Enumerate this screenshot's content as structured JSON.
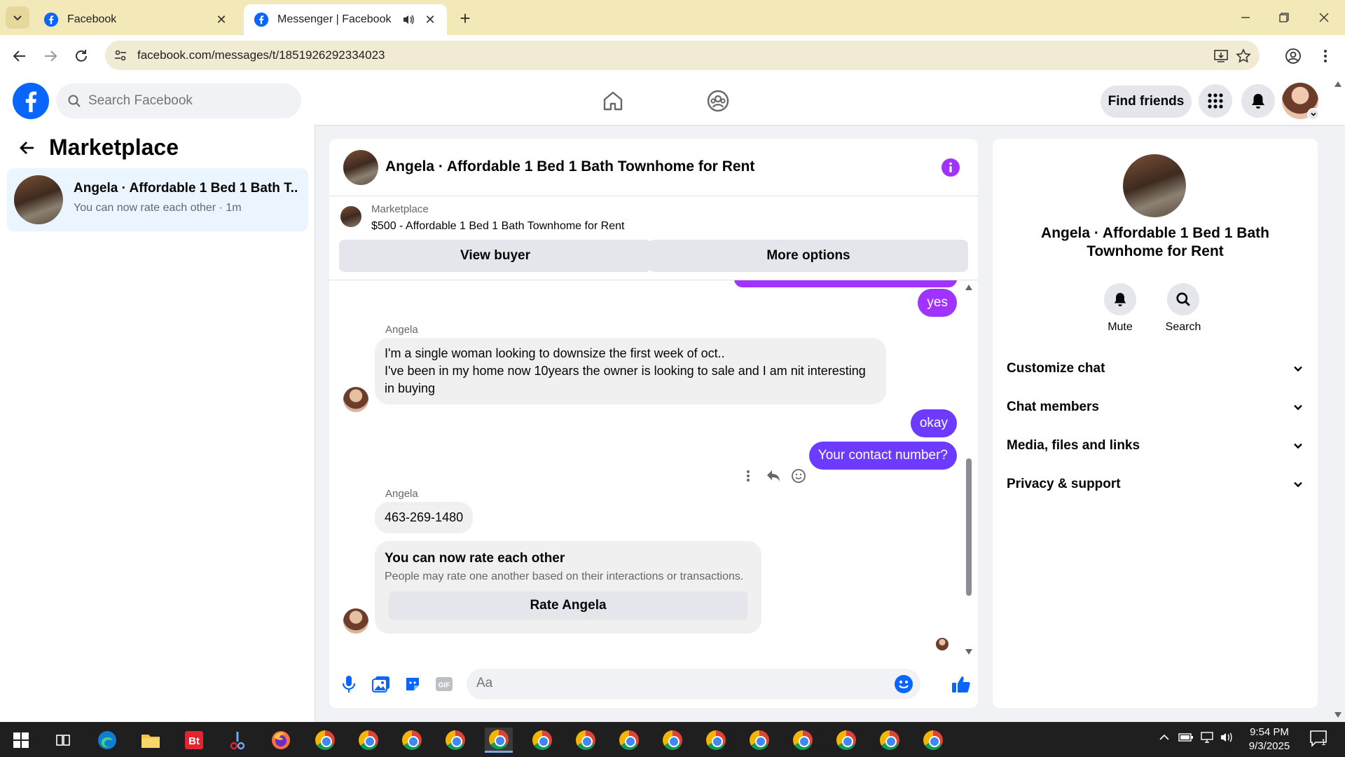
{
  "browser": {
    "tabs": [
      {
        "title": "Facebook",
        "active": false
      },
      {
        "title": "Messenger | Facebook",
        "active": true
      }
    ],
    "url": "facebook.com/messages/t/1851926292334023"
  },
  "fb_header": {
    "search_placeholder": "Search Facebook",
    "find_friends_label": "Find friends"
  },
  "sidebar": {
    "title": "Marketplace",
    "conversation": {
      "name": "Angela · Affordable 1 Bed 1 Bath T...",
      "preview": "You can now rate each other · 1m"
    }
  },
  "chat": {
    "title": "Angela · Affordable 1 Bed 1 Bath Townhome for Rent",
    "listing": {
      "source": "Marketplace",
      "description": "$500 - Affordable 1 Bed 1 Bath Townhome for Rent",
      "view_buyer_label": "View buyer",
      "more_options_label": "More options"
    },
    "messages": {
      "out_yes": "yes",
      "sender1": "Angela",
      "in_long_line1": "I'm a single woman looking to downsize the first week of oct..",
      "in_long_line2": "I've been in my home now 10years the owner is looking to sale and I am nit interesting in buying",
      "out_okay": "okay",
      "out_contact": "Your contact number?",
      "sender2": "Angela",
      "in_phone": "463-269-1480"
    },
    "rate_card": {
      "title": "You can now rate each other",
      "subtitle": "People may rate one another based on their interactions or transactions.",
      "button_label": "Rate Angela"
    },
    "composer": {
      "placeholder": "Aa"
    }
  },
  "info_pane": {
    "name": "Angela · Affordable 1 Bed 1 Bath Townhome for Rent",
    "actions": [
      {
        "label": "Mute",
        "icon": "bell-icon"
      },
      {
        "label": "Search",
        "icon": "search-icon"
      }
    ],
    "sections": [
      {
        "label": "Customize chat"
      },
      {
        "label": "Chat members"
      },
      {
        "label": "Media, files and links"
      },
      {
        "label": "Privacy & support"
      }
    ]
  },
  "taskbar": {
    "time": "9:54 PM",
    "date": "9/3/2025",
    "notification_count": "1"
  },
  "colors": {
    "fb_blue": "#0866ff",
    "outgoing_bubble": "#a033ff",
    "outgoing_bubble_alt": "#6c3bff",
    "info_icon": "#a033ff",
    "selected_conversation_bg": "#ebf5ff"
  }
}
